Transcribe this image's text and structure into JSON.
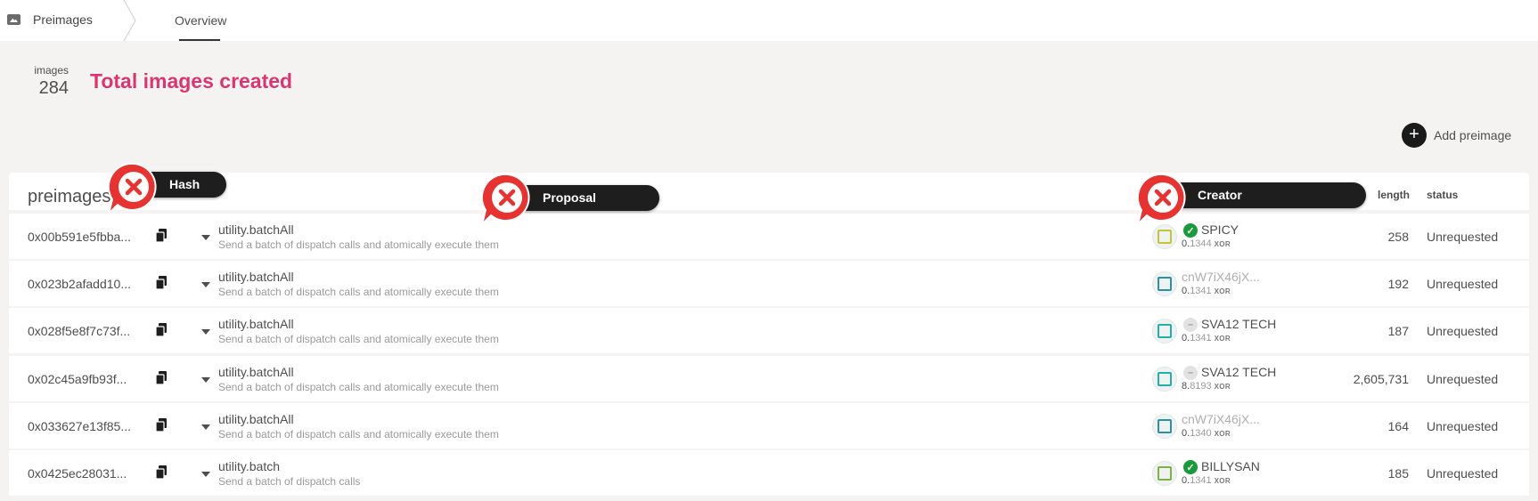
{
  "nav": {
    "brand": "Preimages",
    "tab": "Overview"
  },
  "summary": {
    "label": "images",
    "value": "284"
  },
  "annotations": {
    "note": "Total images created",
    "hash": "Hash",
    "proposal": "Proposal",
    "creator": "Creator"
  },
  "actions": {
    "add_label": "Add preimage",
    "add_icon": "plus-icon"
  },
  "table": {
    "title": "preimages",
    "columns": {
      "length": "length",
      "status": "status"
    },
    "rows": [
      {
        "hash": "0x00b591e5fbba...",
        "call": "utility.batchAll",
        "desc": "Send a batch of dispatch calls and atomically execute them",
        "account": "SPICY",
        "verified": true,
        "balance_lead": "0.",
        "balance_rest": "1344",
        "unit": "XOR",
        "length": "258",
        "status": "Unrequested"
      },
      {
        "hash": "0x023b2afadd10...",
        "call": "utility.batchAll",
        "desc": "Send a batch of dispatch calls and atomically execute them",
        "account": "cnW7iX46jX...",
        "verified": null,
        "balance_lead": "0.",
        "balance_rest": "1341",
        "unit": "XOR",
        "length": "192",
        "status": "Unrequested"
      },
      {
        "hash": "0x028f5e8f7c73f...",
        "call": "utility.batchAll",
        "desc": "Send a batch of dispatch calls and atomically execute them",
        "account": "SVA12 TECH",
        "verified": false,
        "balance_lead": "0.",
        "balance_rest": "1341",
        "unit": "XOR",
        "length": "187",
        "status": "Unrequested"
      },
      {
        "hash": "0x02c45a9fb93f...",
        "call": "utility.batchAll",
        "desc": "Send a batch of dispatch calls and atomically execute them",
        "account": "SVA12 TECH",
        "verified": false,
        "balance_lead": "8.",
        "balance_rest": "8193",
        "unit": "XOR",
        "length": "2,605,731",
        "status": "Unrequested"
      },
      {
        "hash": "0x033627e13f85...",
        "call": "utility.batchAll",
        "desc": "Send a batch of dispatch calls and atomically execute them",
        "account": "cnW7iX46jX...",
        "verified": null,
        "balance_lead": "0.",
        "balance_rest": "1340",
        "unit": "XOR",
        "length": "164",
        "status": "Unrequested"
      },
      {
        "hash": "0x0425ec28031...",
        "call": "utility.batch",
        "desc": "Send a batch of dispatch calls",
        "account": "BILLYSAN",
        "verified": true,
        "balance_lead": "0.",
        "balance_rest": "1341",
        "unit": "XOR",
        "length": "185",
        "status": "Unrequested"
      }
    ]
  },
  "colors": {
    "accent_pink": "#e5306c",
    "callout_red": "#e8322f",
    "verified_green": "#1a9b3a",
    "background": "#f4f3f1"
  }
}
